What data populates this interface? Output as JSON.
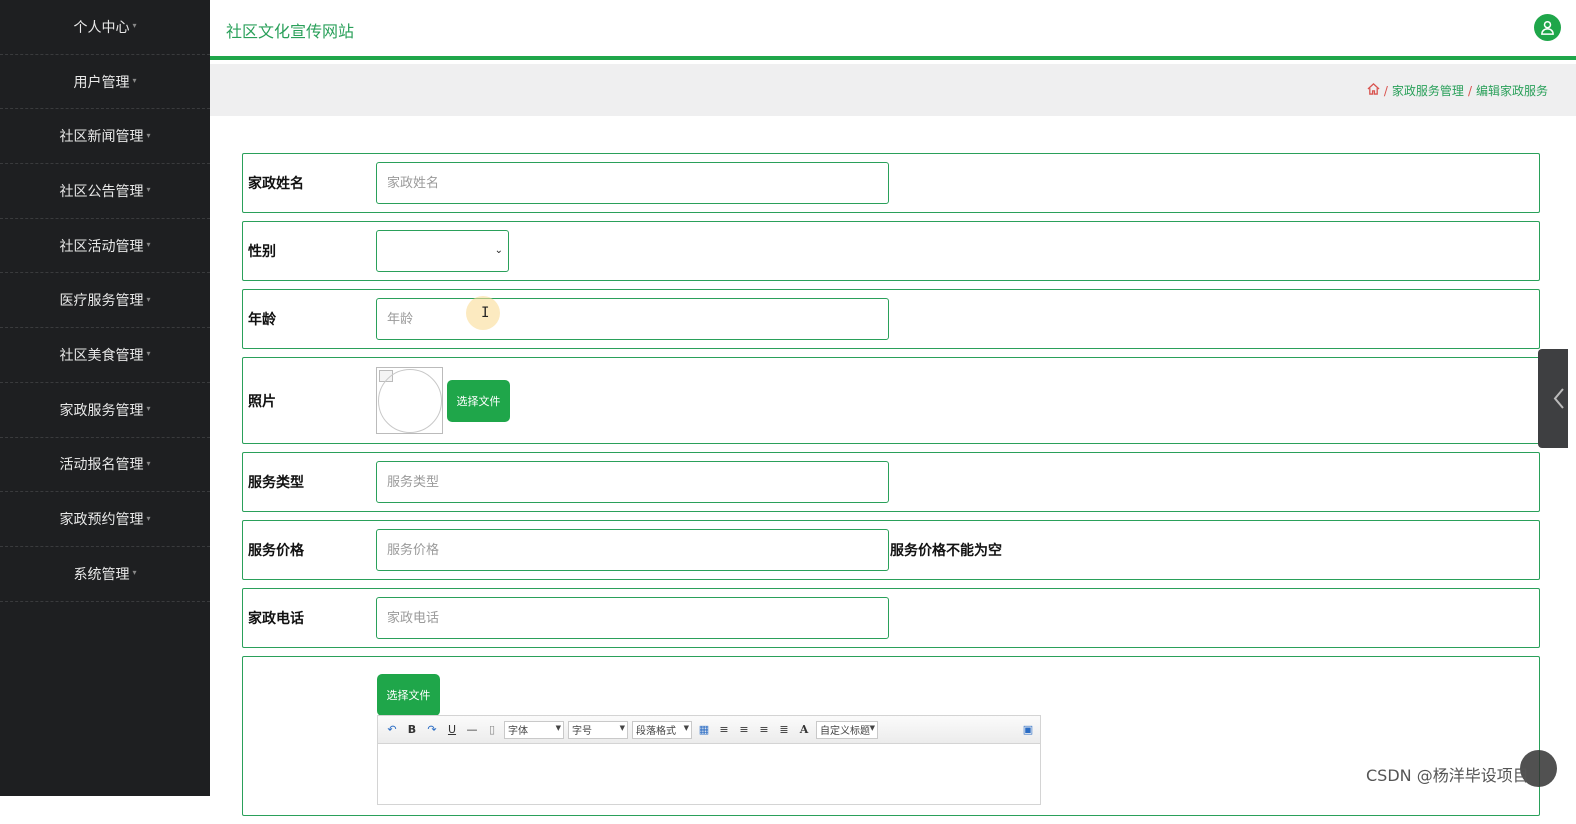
{
  "sidebar": {
    "items": [
      {
        "label": "个人中心"
      },
      {
        "label": "用户管理"
      },
      {
        "label": "社区新闻管理"
      },
      {
        "label": "社区公告管理"
      },
      {
        "label": "社区活动管理"
      },
      {
        "label": "医疗服务管理"
      },
      {
        "label": "社区美食管理"
      },
      {
        "label": "家政服务管理"
      },
      {
        "label": "活动报名管理"
      },
      {
        "label": "家政预约管理"
      },
      {
        "label": "系统管理"
      }
    ]
  },
  "header": {
    "title": "社区文化宣传网站",
    "avatar_icon": "user-icon"
  },
  "breadcrumb": {
    "home_icon": "home-icon",
    "sep1": "/",
    "item1": "家政服务管理",
    "sep2": "/",
    "item2": "编辑家政服务"
  },
  "form": {
    "name": {
      "label": "家政姓名",
      "placeholder": "家政姓名"
    },
    "gender": {
      "label": "性别",
      "value": ""
    },
    "age": {
      "label": "年龄",
      "placeholder": "年龄"
    },
    "photo": {
      "label": "照片",
      "button": "选择文件"
    },
    "service_type": {
      "label": "服务类型",
      "placeholder": "服务类型"
    },
    "price": {
      "label": "服务价格",
      "placeholder": "服务价格",
      "error": "服务价格不能为空"
    },
    "phone": {
      "label": "家政电话",
      "placeholder": "家政电话"
    },
    "detail": {
      "button": "选择文件"
    }
  },
  "editor": {
    "font": "字体",
    "size": "字号",
    "para": "段落格式",
    "custom": "自定义标题",
    "bold": "B",
    "underline": "U",
    "font_color": "A"
  },
  "watermark": "CSDN @杨洋毕设项目",
  "colors": {
    "accent": "#1fa64a",
    "sidebar": "#1e1f21",
    "error_sep": "#d9534f"
  }
}
